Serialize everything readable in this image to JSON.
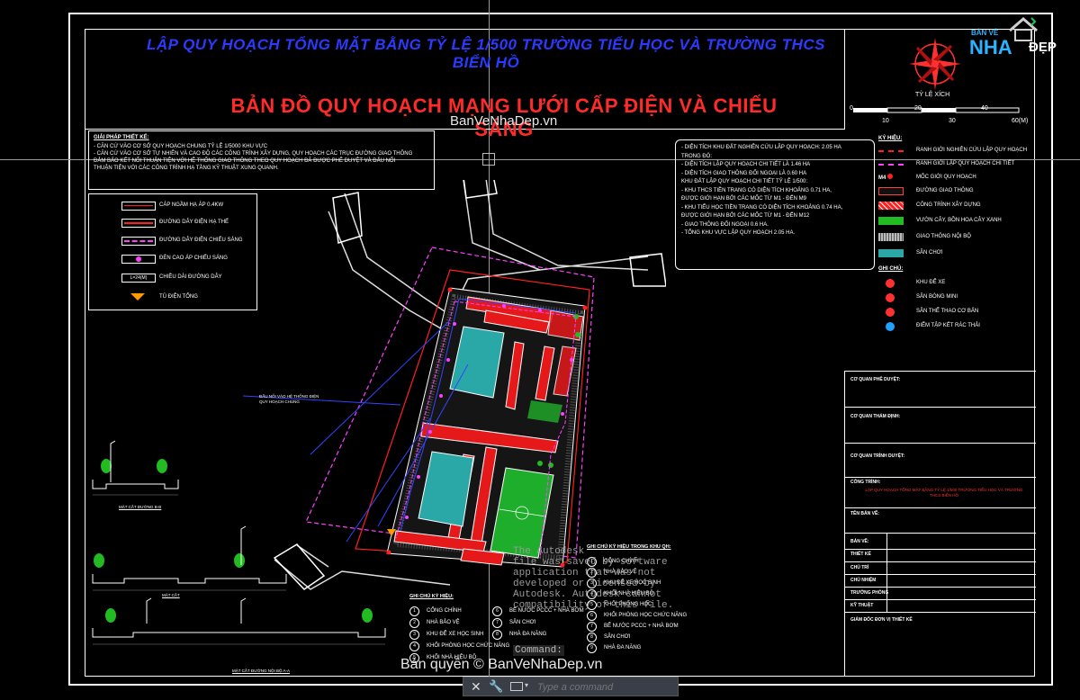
{
  "drawing": {
    "title1": "LẬP QUY HOẠCH TỔNG MẶT BẰNG TỶ LỆ 1/500 TRƯỜNG TIỂU HỌC VÀ TRƯỜNG THCS BIỂN HỒ",
    "title2": "BẢN ĐỒ QUY HOẠCH MẠNG LƯỚI CẤP ĐIỆN VÀ CHIẾU SÁNG",
    "watermark": "BanVeNhaDep.vn",
    "copyright": "Bản quyền © BanVeNhaDep.vn",
    "scale_label": "TỶ LỆ XÍCH",
    "scale_ticks": [
      "0",
      "10",
      "20",
      "30",
      "40",
      "60(M)"
    ],
    "annotation_center": "ĐẤU NỐI VÀO HỆ THỐNG ĐIỆN QUY HOẠCH CHUNG"
  },
  "brand": {
    "line1": "BẢN VẼ",
    "nha": "NHA",
    "dep": "ĐẸP"
  },
  "notes": {
    "header": "GIẢI PHÁP THIẾT KẾ:",
    "line1": "- CĂN CỨ VÀO CƠ SỞ QUY HOẠCH CHUNG TỶ LỆ 1/5000 KHU VỰC",
    "line2": "- CĂN CỨ VÀO CƠ SỞ TỰ NHIÊN VÀ CAO ĐỘ CÁC CÔNG TRÌNH XÂY DỰNG, QUY HOẠCH CÁC TRỤC ĐƯỜNG GIAO THÔNG",
    "line3": "ĐẢM BẢO KẾT NỐI THUẬN TIỆN VỚI HỆ THỐNG GIAO THÔNG THEO QUY HOẠCH ĐÃ ĐƯỢC PHÊ DUYỆT VÀ ĐẤU NỐI",
    "line4": "THUẬN TIỆN VỚI CÁC CÔNG TRÌNH HẠ TẦNG KỸ THUẬT XUNG QUANH."
  },
  "left_legend": [
    {
      "label": "CÁP NGẦM HẠ ÁP 0.4KW",
      "color": "#ff2020"
    },
    {
      "label": "ĐƯỜNG DÂY ĐIỆN HẠ THẾ",
      "color": "#ff2020"
    },
    {
      "label": "ĐƯỜNG DÂY ĐIỆN CHIẾU SÁNG",
      "color": "#ff40ff"
    },
    {
      "label": "ĐÈN CAO ÁP CHIẾU SÁNG",
      "color": "#ff40ff"
    },
    {
      "label": "CHIỀU DÀI ĐƯỜNG DÂY",
      "color": "#cccccc",
      "sym_text": "L=24(M)"
    },
    {
      "label": "TỦ ĐIỆN TỔNG",
      "color": "#ff9900"
    }
  ],
  "stats": [
    "- DIỆN TÍCH KHU ĐẤT NGHIÊN CỨU LẬP QUY HOẠCH: 2.05 HA",
    "TRONG ĐÓ:",
    "- DIỆN TÍCH LẬP QUY HOẠCH CHI TIẾT LÀ 1.46 HA",
    "- DIỆN TÍCH GIAO THÔNG ĐỐI NGOẠI LÀ 0.60 HA",
    "KHU ĐẤT LẬP QUY HOẠCH CHI TIẾT TỶ LỆ 1/500:",
    "- KHU THCS TIỀN TRANG CÓ DIỆN TÍCH KHOẢNG 0.71 HA,",
    "ĐƯỢC GIỚI HẠN BỞI CÁC MỐC TỪ M1 - ĐẾN M9",
    "- KHU TIỂU HỌC TIỀN TRANG CÓ DIỆN TÍCH KHOẢNG 0.74 HA,",
    "ĐƯỢC GIỚI HẠN BỞI CÁC MỐC TỪ M1 - ĐẾN M12",
    "- GIAO THÔNG ĐỐI NGOẠI 0.6 HA.",
    "- TỔNG KHU VỰC LẬP QUY HOẠCH 2.05 HA."
  ],
  "right_legend": {
    "header": "KÝ HIỆU:",
    "items": [
      {
        "label": "RANH GIỚI NGHIÊN CỨU LẬP QUY HOẠCH",
        "color": "#ff2020"
      },
      {
        "label": "RANH GIỚI LẬP QUY HOẠCH CHI TIẾT",
        "color": "#ff40ff"
      },
      {
        "label": "MỐC GIỚI QUY HOẠCH",
        "color": "#ffffff"
      },
      {
        "label": "ĐƯỜNG GIAO THÔNG",
        "color": "#ff4040"
      },
      {
        "label": "CÔNG TRÌNH XÂY DỰNG",
        "color": "#ff2020"
      },
      {
        "label": "VƯỜN CÂY, BỒN HOA CÂY XANH",
        "color": "#22bb22"
      },
      {
        "label": "GIAO THÔNG NỘI BỘ",
        "color": "#bbbbbb"
      },
      {
        "label": "SÂN CHƠI",
        "color": "#2aa8a8"
      }
    ],
    "header2": "GHI CHÚ:",
    "items2": [
      {
        "label": "KHU ĐỂ XE",
        "color": "#ff3030"
      },
      {
        "label": "SÂN BÓNG MINI",
        "color": "#ff3030"
      },
      {
        "label": "SÂN THỂ THAO CƠ BẢN",
        "color": "#ff3030"
      },
      {
        "label": "ĐIỂM TẬP KẾT RÁC THẢI",
        "color": "#20a0ff"
      }
    ]
  },
  "title_block": {
    "rows": [
      "CƠ QUAN PHÊ DUYỆT:",
      "CƠ QUAN THẨM ĐỊNH:",
      "CƠ QUAN TRÌNH DUYỆT:",
      "CÔNG TRÌNH:",
      "TÊN BẢN VẼ:",
      "BẢN VẼ:",
      "THIẾT KẾ",
      "CHỦ TRÌ",
      "CHỦ NHIỆM",
      "TRƯỞNG PHÒNG",
      "KỸ THUẬT",
      "GIÁM ĐỐC ĐƠN VỊ THIẾT KẾ"
    ],
    "project": "LẬP QUY HOẠCH TỔNG MẶT BẰNG TỶ LỆ 1/500 TRƯỜNG TIỂU HỌC VÀ TRƯỜNG THCS BIỂN HỒ"
  },
  "list1": {
    "header": "GHI CHÚ KÝ HIỆU:",
    "items": [
      "CỔNG CHÍNH",
      "NHÀ BẢO VỆ",
      "KHU ĐỂ XE HỌC SINH",
      "KHỐI PHÒNG HỌC CHỨC NĂNG",
      "KHỐI NHÀ HIỆU BỘ"
    ],
    "items_b": [
      "BỂ NƯỚC PCCC + NHÀ BƠM",
      "SÂN CHƠI",
      "NHÀ ĐA NĂNG"
    ]
  },
  "list2": {
    "header": "GHI CHÚ KÝ HIỆU TRONG KHU QH:",
    "items": [
      "CỔNG CHÍNH",
      "NHÀ BẢO VỆ",
      "KHU ĐỂ XE HỌC SINH",
      "KHỐI NHÀ HIỆU BỘ",
      "KHỐI PHÒNG HỌC",
      "KHỐI PHÒNG HỌC CHỨC NĂNG",
      "BỂ NƯỚC PCCC + NHÀ BƠM",
      "SÂN CHƠI",
      "NHÀ ĐA NĂNG"
    ]
  },
  "overlay": {
    "lines": [
      "The Autodesk",
      "file was saved by software",
      "application that was not",
      "developed or licensed by",
      "Autodesk.  Autodesk cannot",
      "compatibility of this file."
    ],
    "command_label": "Command:",
    "placeholder": "Type a command"
  },
  "sections": {
    "a": "MẶT CẮT ĐƯỜNG B-B",
    "b": "MẶT CẮT",
    "c": "MẶT CẮT ĐƯỜNG NỘI BỘ A-A"
  }
}
